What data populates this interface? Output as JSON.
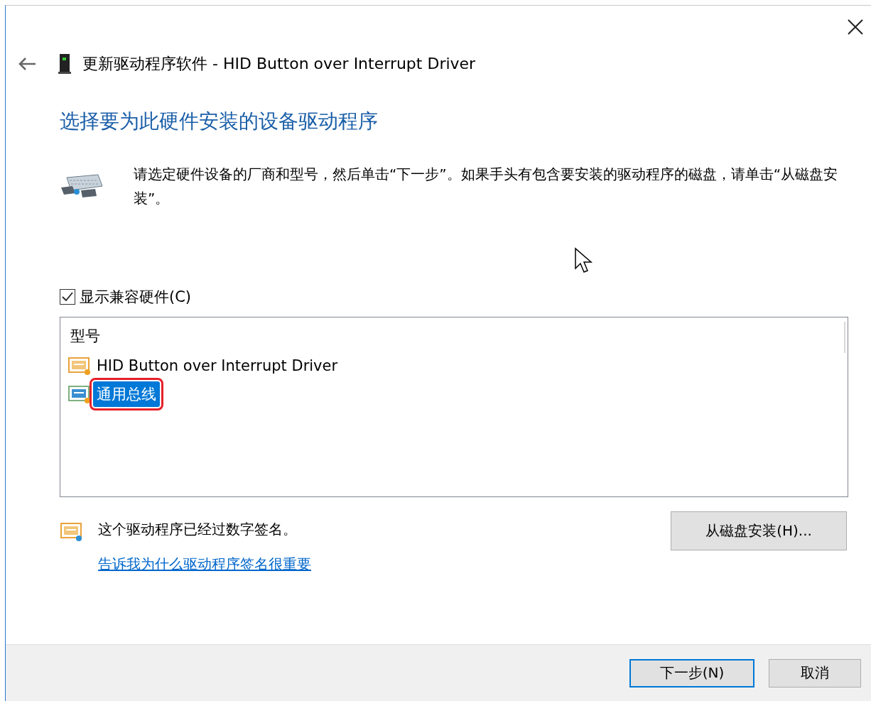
{
  "window": {
    "title": "更新驱动程序软件 - HID Button over Interrupt Driver"
  },
  "heading": "选择要为此硬件安装的设备驱动程序",
  "instructions": "请选定硬件设备的厂商和型号，然后单击“下一步”。如果手头有包含要安装的驱动程序的磁盘，请单击“从磁盘安装”。",
  "show_compatible": {
    "label": "显示兼容硬件(C)",
    "checked": true
  },
  "model_list": {
    "header": "型号",
    "items": [
      {
        "label": "HID Button over Interrupt Driver",
        "selected": false,
        "highlighted": false
      },
      {
        "label": "通用总线",
        "selected": true,
        "highlighted": true
      }
    ]
  },
  "signature": {
    "text": "这个驱动程序已经过数字签名。",
    "link": "告诉我为什么驱动程序签名很重要"
  },
  "have_disk_button": "从磁盘安装(H)...",
  "footer_buttons": [
    {
      "label": "下一步(N)",
      "default": true
    },
    {
      "label": "取消",
      "default": false
    }
  ]
}
